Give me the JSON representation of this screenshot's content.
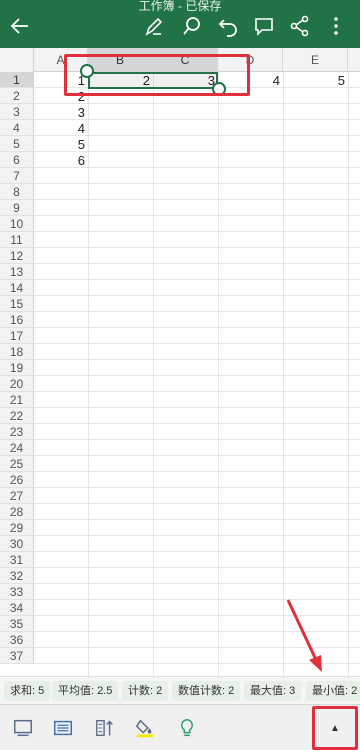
{
  "app": {
    "title": "工作簿 - 已保存",
    "theme_color": "#217346"
  },
  "toolbar_top": {
    "icons": [
      "back-arrow-icon",
      "pen-icon",
      "search-icon",
      "undo-icon",
      "comment-icon",
      "share-icon",
      "more-icon"
    ]
  },
  "sheet": {
    "columns": [
      "A",
      "B",
      "C",
      "D",
      "E"
    ],
    "rows": [
      "1",
      "2",
      "3",
      "4",
      "5",
      "6",
      "7",
      "8",
      "9",
      "10",
      "11",
      "12",
      "13",
      "14",
      "15",
      "16",
      "17",
      "18",
      "19",
      "20",
      "21",
      "22",
      "23",
      "24",
      "25",
      "26",
      "27",
      "28",
      "29",
      "30",
      "31",
      "32",
      "33",
      "34",
      "35",
      "36",
      "37"
    ],
    "row1": {
      "A": "1",
      "B": "2",
      "C": "3",
      "D": "4",
      "E": "5"
    },
    "colA": [
      "1",
      "2",
      "3",
      "4",
      "5",
      "6"
    ],
    "selection": "B1:C1"
  },
  "status": {
    "items": [
      "求和: 5",
      "平均值: 2.5",
      "计数: 2",
      "数值计数: 2",
      "最大值: 3",
      "最小值: 2"
    ]
  },
  "bottom_toolbar": {
    "icons": [
      "sheet-view-icon",
      "card-view-icon",
      "sort-icon",
      "fill-color-icon",
      "idea-lightbulb-icon"
    ],
    "expand_label": "▲"
  },
  "annotation_color": "#e0313a"
}
